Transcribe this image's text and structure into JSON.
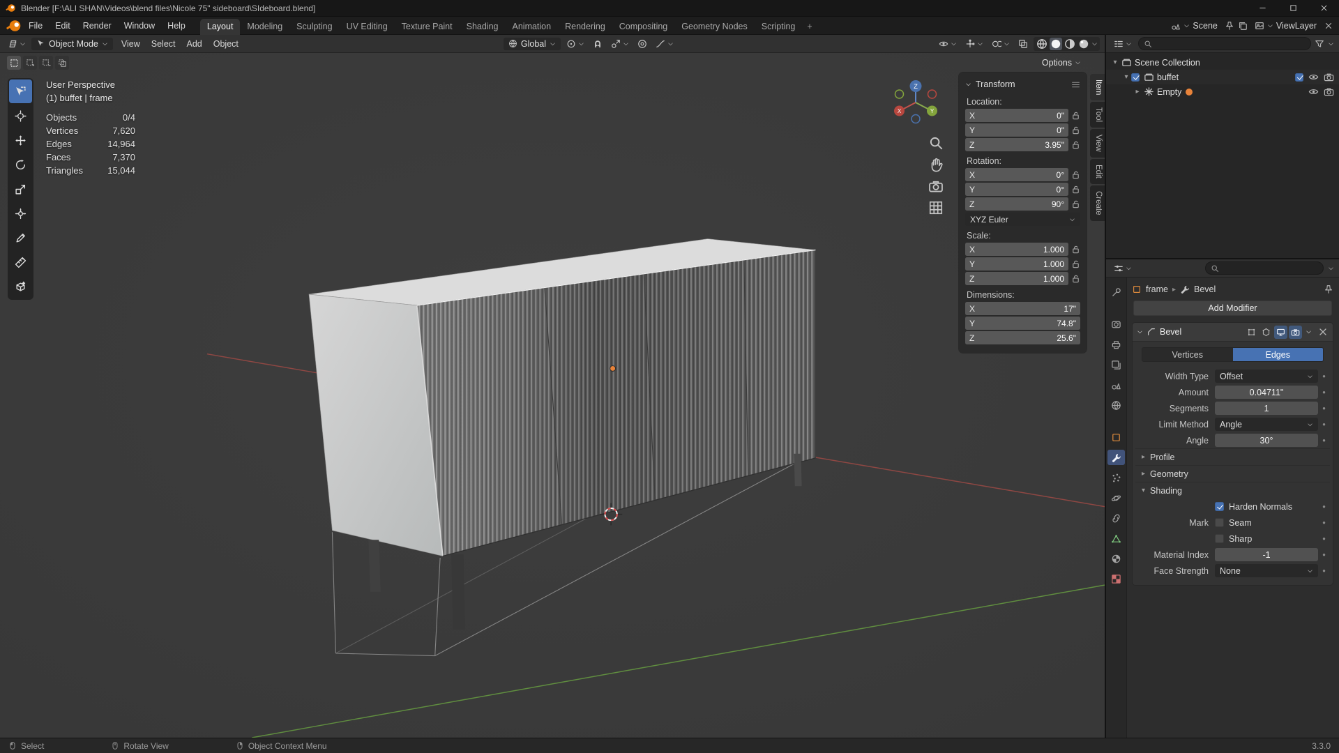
{
  "window": {
    "title": "Blender [F:\\ALI SHAN\\Videos\\blend files\\Nicole 75\" sideboard\\SIdeboard.blend]"
  },
  "topbar": {
    "menus": [
      "File",
      "Edit",
      "Render",
      "Window",
      "Help"
    ],
    "workspaces": [
      "Layout",
      "Modeling",
      "Sculpting",
      "UV Editing",
      "Texture Paint",
      "Shading",
      "Animation",
      "Rendering",
      "Compositing",
      "Geometry Nodes",
      "Scripting"
    ],
    "active_workspace": "Layout",
    "add_workspace": "+",
    "scene": "Scene",
    "view_layer": "ViewLayer"
  },
  "viewport_header": {
    "mode": "Object Mode",
    "menus": [
      "View",
      "Select",
      "Add",
      "Object"
    ],
    "orientation": "Global",
    "options": "Options"
  },
  "tools": [
    "select-box",
    "cursor",
    "move",
    "rotate",
    "scale",
    "transform",
    "annotate",
    "measure",
    "add-cube"
  ],
  "viewport": {
    "view_label": "User Perspective",
    "context_label": "(1) buffet | frame",
    "stats": [
      {
        "label": "Objects",
        "value": "0/4"
      },
      {
        "label": "Vertices",
        "value": "7,620"
      },
      {
        "label": "Edges",
        "value": "14,964"
      },
      {
        "label": "Faces",
        "value": "7,370"
      },
      {
        "label": "Triangles",
        "value": "15,044"
      }
    ],
    "gizmo": {
      "x": "X",
      "y": "Y",
      "z": "Z"
    }
  },
  "side_tabs": [
    {
      "label": "Item",
      "active": true
    },
    {
      "label": "Tool",
      "active": false
    },
    {
      "label": "View",
      "active": false
    },
    {
      "label": "Edit",
      "active": false
    },
    {
      "label": "Create",
      "active": false
    }
  ],
  "transform_panel": {
    "title": "Transform",
    "groups": [
      {
        "key": "location",
        "label": "Location:",
        "lock": true,
        "rows": [
          {
            "axis": "X",
            "value": "0\""
          },
          {
            "axis": "Y",
            "value": "0\""
          },
          {
            "axis": "Z",
            "value": "3.95\""
          }
        ]
      },
      {
        "key": "rotation",
        "label": "Rotation:",
        "lock": true,
        "dropdown": "XYZ Euler",
        "rows": [
          {
            "axis": "X",
            "value": "0°"
          },
          {
            "axis": "Y",
            "value": "0°"
          },
          {
            "axis": "Z",
            "value": "90°"
          }
        ]
      },
      {
        "key": "scale",
        "label": "Scale:",
        "lock": true,
        "rows": [
          {
            "axis": "X",
            "value": "1.000"
          },
          {
            "axis": "Y",
            "value": "1.000"
          },
          {
            "axis": "Z",
            "value": "1.000"
          }
        ]
      },
      {
        "key": "dimensions",
        "label": "Dimensions:",
        "lock": false,
        "rows": [
          {
            "axis": "X",
            "value": "17\""
          },
          {
            "axis": "Y",
            "value": "74.8\""
          },
          {
            "axis": "Z",
            "value": "25.6\""
          }
        ]
      }
    ]
  },
  "outliner": {
    "rows": [
      {
        "label": "Scene Collection",
        "depth": 0,
        "icon": "collection",
        "disclosure": "open",
        "checkbox": false,
        "badge": false,
        "right": []
      },
      {
        "label": "buffet",
        "depth": 1,
        "icon": "collection",
        "disclosure": "open",
        "checkbox": true,
        "badge": false,
        "right": [
          "checkbox",
          "eye",
          "camera"
        ]
      },
      {
        "label": "Empty",
        "depth": 2,
        "icon": "empty",
        "disclosure": "closed",
        "checkbox": false,
        "badge": true,
        "right": [
          "eye",
          "camera"
        ]
      }
    ]
  },
  "properties": {
    "breadcrumb": {
      "object": "frame",
      "modifier": "Bevel"
    },
    "nav_tabs": [
      "tool",
      "render",
      "output",
      "viewlayer",
      "scene",
      "world",
      "object",
      "modifiers",
      "particles",
      "physics",
      "constraints",
      "data",
      "material",
      "texture"
    ],
    "active_tab": "modifiers",
    "add_modifier": "Add Modifier",
    "modifier": {
      "name": "Bevel",
      "affect": [
        {
          "label": "Vertices",
          "active": false
        },
        {
          "label": "Edges",
          "active": true
        }
      ],
      "params": [
        {
          "type": "dropdown",
          "label": "Width Type",
          "value": "Offset"
        },
        {
          "type": "number",
          "label": "Amount",
          "value": "0.04711\""
        },
        {
          "type": "number",
          "label": "Segments",
          "value": "1"
        },
        {
          "type": "dropdown",
          "label": "Limit Method",
          "value": "Angle"
        },
        {
          "type": "number",
          "label": "Angle",
          "value": "30°"
        }
      ],
      "sections": [
        {
          "label": "Profile",
          "expanded": false
        },
        {
          "label": "Geometry",
          "expanded": false
        },
        {
          "label": "Shading",
          "expanded": true
        }
      ],
      "shading_rows": [
        {
          "type": "checkbox",
          "row_label": "",
          "label": "Harden Normals",
          "checked": true
        },
        {
          "type": "checkbox",
          "row_label": "Mark",
          "label": "Seam",
          "checked": false
        },
        {
          "type": "checkbox",
          "row_label": "",
          "label": "Sharp",
          "checked": false
        },
        {
          "type": "number",
          "row_label": "Material Index",
          "value": "-1"
        },
        {
          "type": "dropdown",
          "row_label": "Face Strength",
          "value": "None"
        }
      ]
    }
  },
  "statusbar": {
    "items": [
      {
        "icon": "mouseL",
        "label": "Select"
      },
      {
        "icon": "mouseM",
        "label": "Rotate View"
      },
      {
        "icon": "mouseR",
        "label": "Object Context Menu"
      }
    ],
    "version": "3.3.0"
  },
  "colors": {
    "accent": "#4772b3",
    "axis_x": "#9e4a45",
    "axis_y": "#679d41",
    "origin": "#e8833a"
  }
}
